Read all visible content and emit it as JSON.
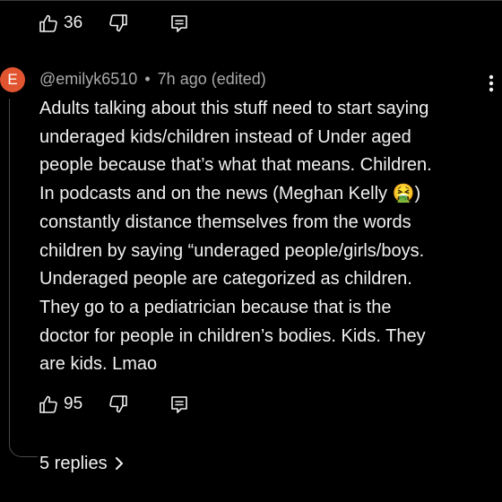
{
  "previous_comment": {
    "like_count": "36"
  },
  "comment": {
    "avatar_initial": "E",
    "handle": "@emilyk6510",
    "separator": "•",
    "time": "7h ago (edited)",
    "body": "Adults talking about this stuff need to start saying\nunderaged kids/children instead of Under aged\npeople because that’s what that means. Children.\nIn podcasts and on the news (Meghan Kelly 🤮)\nconstantly distance themselves from the words\nchildren by saying “underaged people/girls/boys.\nUnderaged people are categorized as children.\nThey go to a pediatrician because that is the\ndoctor for people in children’s bodies. Kids. They\nare kids. Lmao",
    "like_count": "95",
    "replies_label": "5 replies"
  },
  "icons": {
    "like": "thumbs-up-icon",
    "dislike": "thumbs-down-icon",
    "reply": "reply-comment-icon",
    "menu": "more-vertical-icon",
    "expand": "chevron-right-icon"
  },
  "colors": {
    "background": "#000000",
    "text": "#f1f1f1",
    "meta_text": "#aaaaaa",
    "avatar": "#e0552f"
  }
}
